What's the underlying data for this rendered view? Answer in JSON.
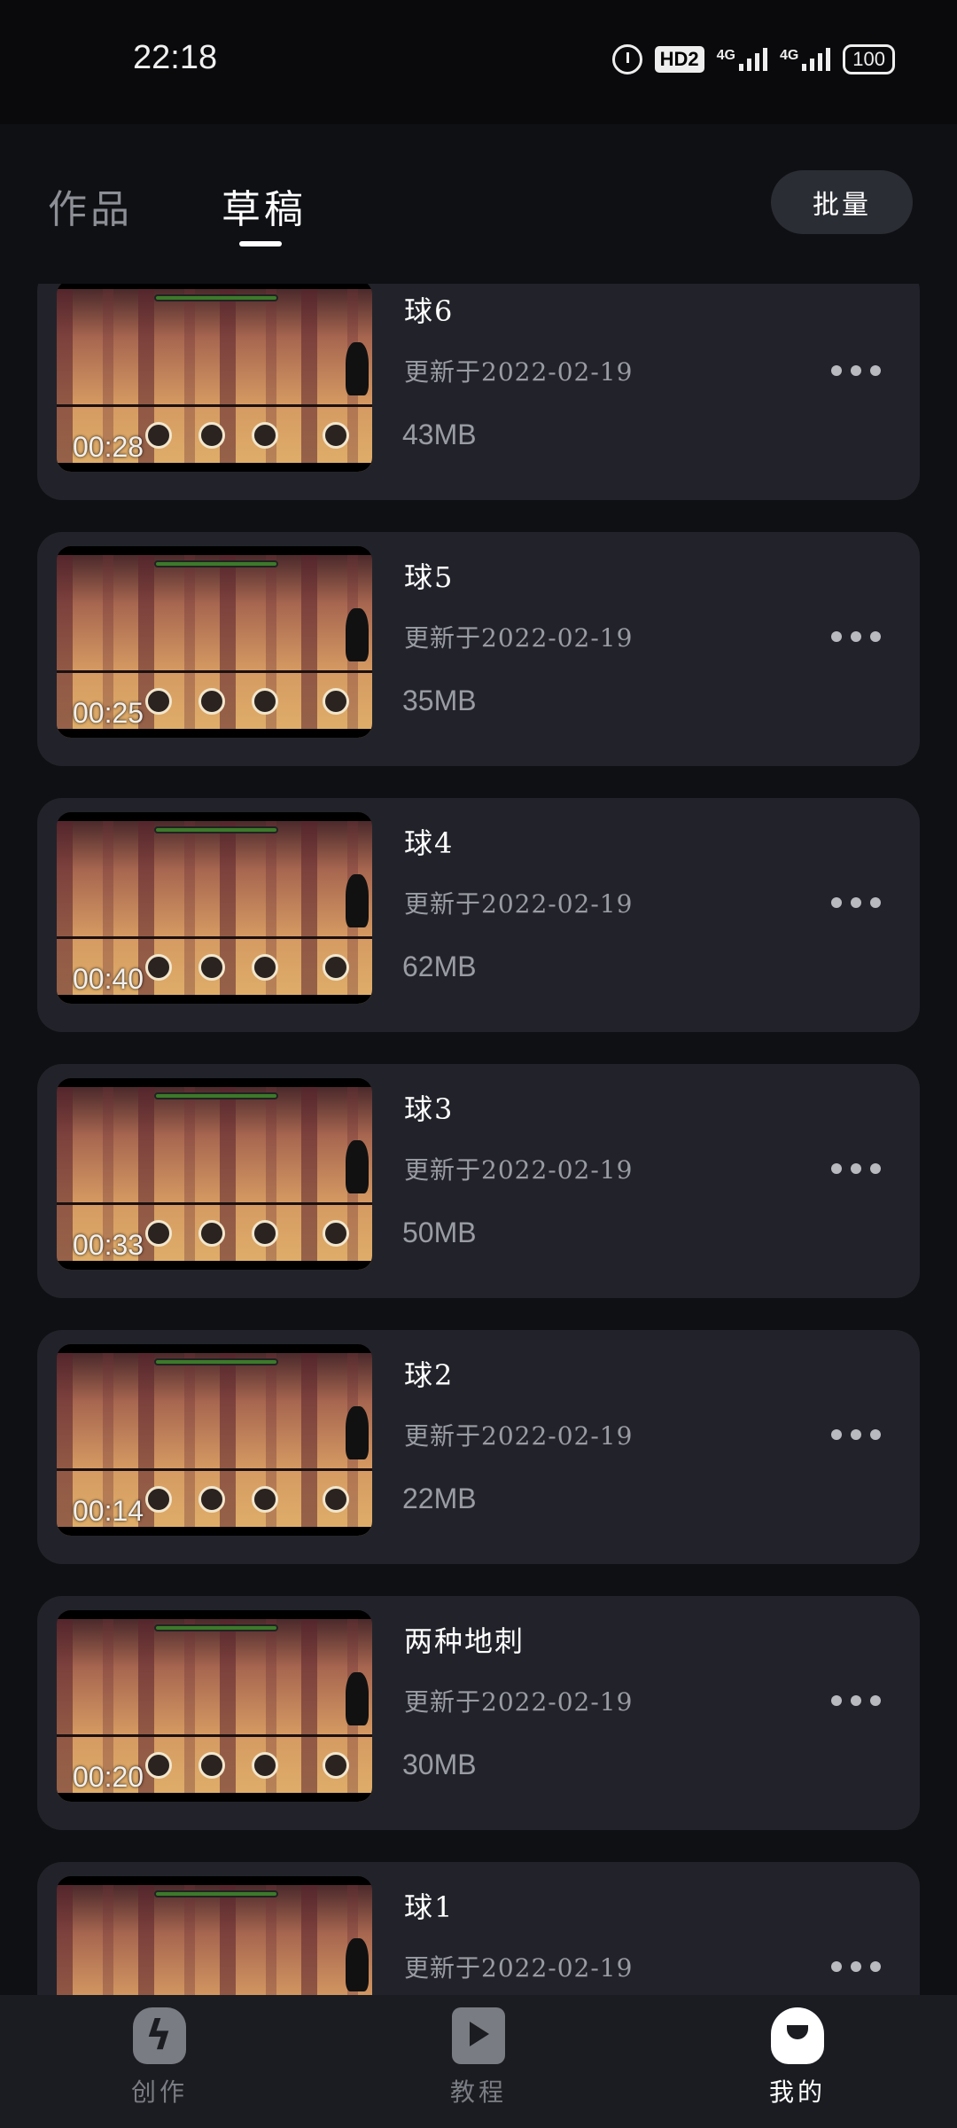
{
  "status_bar": {
    "time": "22:18",
    "hd_label": "HD2",
    "net1_label": "4G",
    "net2_label": "4G",
    "battery": "100"
  },
  "header": {
    "tab_works": "作品",
    "tab_drafts": "草稿",
    "batch_label": "批量"
  },
  "drafts": [
    {
      "title": "球6",
      "updated": "更新于2022-02-19",
      "size": "43MB",
      "duration": "00:28"
    },
    {
      "title": "球5",
      "updated": "更新于2022-02-19",
      "size": "35MB",
      "duration": "00:25"
    },
    {
      "title": "球4",
      "updated": "更新于2022-02-19",
      "size": "62MB",
      "duration": "00:40"
    },
    {
      "title": "球3",
      "updated": "更新于2022-02-19",
      "size": "50MB",
      "duration": "00:33"
    },
    {
      "title": "球2",
      "updated": "更新于2022-02-19",
      "size": "22MB",
      "duration": "00:14"
    },
    {
      "title": "两种地刺",
      "updated": "更新于2022-02-19",
      "size": "30MB",
      "duration": "00:20"
    },
    {
      "title": "球1",
      "updated": "更新于2022-02-19",
      "size": "",
      "duration": ""
    }
  ],
  "bottom_nav": {
    "create": "创作",
    "tutorial": "教程",
    "me": "我的"
  },
  "colors": {
    "background": "#0f1014",
    "card": "#22232a",
    "muted_text": "#9a9ca3",
    "nav_active": "#ffffff",
    "nav_inactive": "#7a7c83"
  },
  "icons": [
    "alarm-icon",
    "hd-icon",
    "signal-icon",
    "battery-icon",
    "more-icon",
    "create-icon",
    "tutorial-icon",
    "me-icon"
  ]
}
